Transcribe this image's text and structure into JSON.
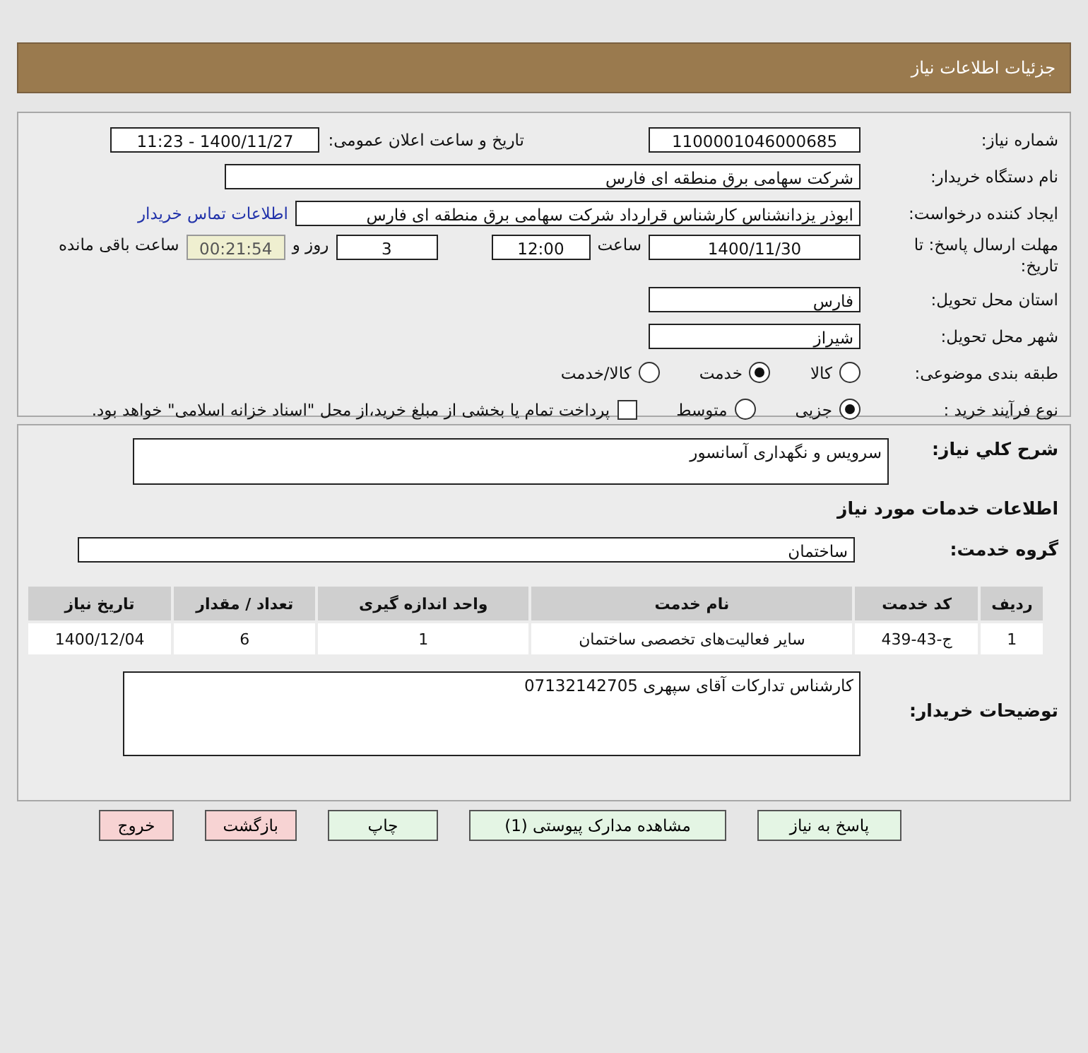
{
  "header": {
    "title": "جزئیات اطلاعات نیاز"
  },
  "need_number": {
    "label": "شماره نیاز:",
    "value": "1100001046000685"
  },
  "announce": {
    "label": "تاریخ و ساعت اعلان عمومی:",
    "value": "1400/11/27 - 11:23"
  },
  "buyer": {
    "label": "نام دستگاه خریدار:",
    "value": "شرکت سهامی برق منطقه ای فارس"
  },
  "creator": {
    "label": "ایجاد کننده درخواست:",
    "value": "ابوذر  یزدانشناس کارشناس قرارداد شرکت سهامی برق منطقه ای فارس",
    "link": "اطلاعات تماس خریدار"
  },
  "deadline": {
    "label": "مهلت ارسال پاسخ: تا تاریخ:",
    "date": "1400/11/30",
    "time_label": "ساعت",
    "time": "12:00",
    "days": "3",
    "days_label": "روز و",
    "remaining": "00:21:54",
    "remaining_label": "ساعت باقی مانده"
  },
  "province": {
    "label": "استان محل تحویل:",
    "value": "فارس"
  },
  "city": {
    "label": "شهر محل تحویل:",
    "value": "شیراز"
  },
  "category": {
    "label": "طبقه بندی موضوعی:",
    "options": [
      {
        "label": "کالا",
        "selected": false
      },
      {
        "label": "خدمت",
        "selected": true
      },
      {
        "label": "کالا/خدمت",
        "selected": false
      }
    ]
  },
  "process": {
    "label": "نوع فرآیند خرید :",
    "options": [
      {
        "label": "جزیی",
        "selected": true
      },
      {
        "label": "متوسط",
        "selected": false
      }
    ],
    "payment": {
      "label": "پرداخت تمام یا بخشی از مبلغ خرید،از محل \"اسناد خزانه اسلامی\" خواهد بود.",
      "checked": false
    }
  },
  "summary": {
    "label": "شرح کلي نياز:",
    "value": "سرویس و نگهداری آسانسور"
  },
  "services_heading": "اطلاعات خدمات مورد نیاز",
  "service_group": {
    "label": "گروه خدمت:",
    "value": "ساختمان"
  },
  "table": {
    "columns": [
      "ردیف",
      "کد خدمت",
      "نام خدمت",
      "واحد اندازه گیری",
      "تعداد / مقدار",
      "تاریخ نیاز"
    ],
    "rows": [
      [
        "1",
        "ج-43-439",
        "سایر فعالیت‌های تخصصی ساختمان",
        "1",
        "6",
        "1400/12/04"
      ]
    ]
  },
  "buyer_notes": {
    "label": "توضیحات خریدار:",
    "value": "کارشناس تدارکات آقای سپهری 07132142705"
  },
  "buttons": [
    {
      "label": "پاسخ به نیاز",
      "kind": "normal"
    },
    {
      "label": "مشاهده مدارک پیوستی (1)",
      "kind": "normal"
    },
    {
      "label": "چاپ",
      "kind": "normal"
    },
    {
      "label": "بازگشت",
      "kind": "danger"
    },
    {
      "label": "خروج",
      "kind": "danger"
    }
  ]
}
